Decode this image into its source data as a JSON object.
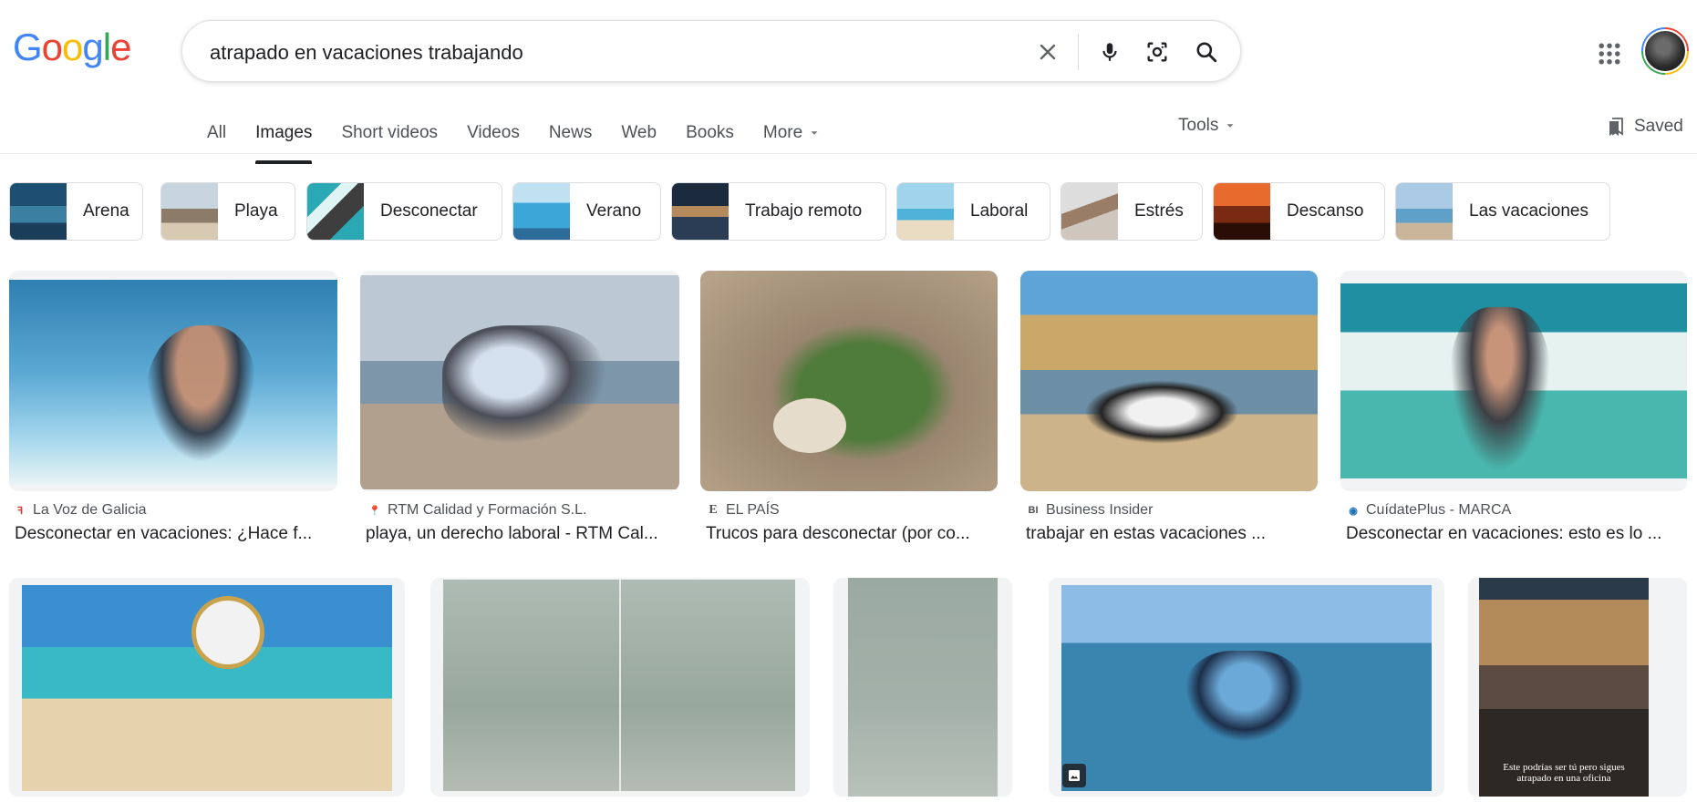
{
  "header": {
    "logo_letters": [
      "G",
      "o",
      "o",
      "g",
      "l",
      "e"
    ],
    "logo_colors": [
      "#4285f4",
      "#ea4335",
      "#fbbc05",
      "#4285f4",
      "#34a853",
      "#ea4335"
    ],
    "query": "atrapado en vacaciones trabajando"
  },
  "tabs": {
    "items": [
      "All",
      "Images",
      "Short videos",
      "Videos",
      "News",
      "Web",
      "Books",
      "More"
    ],
    "active": "Images",
    "tools": "Tools",
    "saved": "Saved"
  },
  "chips": [
    "Arena",
    "Playa",
    "Desconectar",
    "Verano",
    "Trabajo remoto",
    "Laboral",
    "Estrés",
    "Descanso",
    "Las vacaciones"
  ],
  "results_row1": [
    {
      "source": "La Voz de Galicia",
      "title": "Desconectar en vacaciones: ¿Hace f..."
    },
    {
      "source": "RTM Calidad y Formación S.L.",
      "title": "playa, un derecho laboral - RTM Cal..."
    },
    {
      "source": "EL PAÍS",
      "title": "Trucos para desconectar (por co..."
    },
    {
      "source": "Business Insider",
      "title": "trabajar en estas vacaciones ..."
    },
    {
      "source": "CuídatePlus - MARCA",
      "title": "Desconectar en vacaciones: esto es lo ..."
    }
  ],
  "source_icons": [
    "ꟻ",
    "📍",
    "E",
    "BI",
    "◉"
  ],
  "image_caption": "Este podrías ser tú pero sigues atrapado en una oficina",
  "colors": {
    "text_primary": "#202124",
    "text_secondary": "#4d5156",
    "border": "#dadce0"
  }
}
